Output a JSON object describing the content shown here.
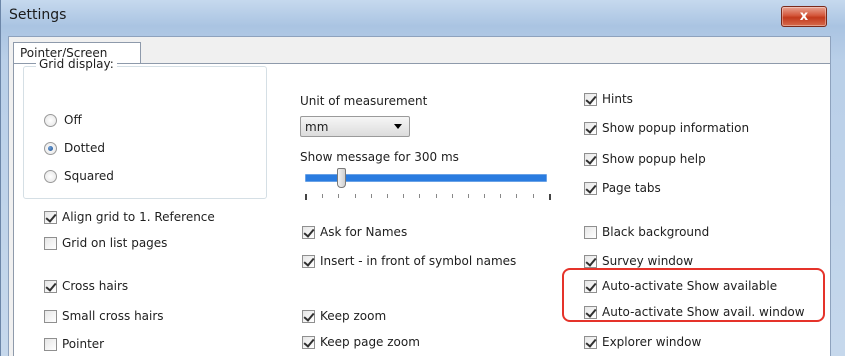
{
  "window": {
    "title": "Settings",
    "close_glyph": "x"
  },
  "tabs": [
    {
      "label": "Pointer/Screen",
      "active": true
    }
  ],
  "grid_display": {
    "legend": "Grid display:",
    "options": [
      {
        "label": "Off",
        "selected": false
      },
      {
        "label": "Dotted",
        "selected": true
      },
      {
        "label": "Squared",
        "selected": false
      }
    ]
  },
  "left_checks": [
    {
      "label": "Align grid to 1. Reference",
      "checked": true
    },
    {
      "label": "Grid on list pages",
      "checked": false
    },
    {
      "label": "Cross hairs",
      "checked": true
    },
    {
      "label": "Small cross hairs",
      "checked": false
    },
    {
      "label": "Pointer",
      "checked": false
    }
  ],
  "middle": {
    "unit_label": "Unit of measurement",
    "unit_value": "mm",
    "message_label": "Show message for 300 ms",
    "slider_value_ms": 300,
    "checks": [
      {
        "label": "Ask for Names",
        "checked": true
      },
      {
        "label": "Insert - in front of symbol names",
        "checked": true
      },
      {
        "label": "Keep zoom",
        "checked": true
      },
      {
        "label": "Keep page zoom",
        "checked": true
      }
    ]
  },
  "right_checks": [
    {
      "label": "Hints",
      "checked": true
    },
    {
      "label": "Show popup information",
      "checked": true
    },
    {
      "label": "Show popup help",
      "checked": true
    },
    {
      "label": "Page tabs",
      "checked": true
    },
    {
      "label": "Black background",
      "checked": false
    },
    {
      "label": "Survey window",
      "checked": true
    },
    {
      "label": "Auto-activate Show available",
      "checked": true
    },
    {
      "label": "Auto-activate Show avail. window",
      "checked": true
    },
    {
      "label": "Explorer window",
      "checked": true
    }
  ],
  "colors": {
    "highlight": "#e5332a",
    "slider": "#2a7ce0",
    "close": "#c9452a"
  }
}
